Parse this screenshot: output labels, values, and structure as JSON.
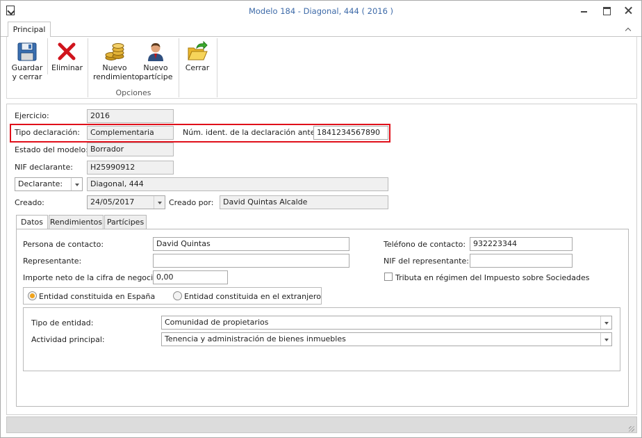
{
  "window": {
    "title": "Modelo 184 - Diagonal, 444 ( 2016 )"
  },
  "ribbon": {
    "tab": "Principal",
    "buttons": {
      "save": [
        "Guardar",
        "y cerrar"
      ],
      "delete": "Eliminar",
      "new_return": [
        "Nuevo",
        "rendimiento"
      ],
      "new_participant": [
        "Nuevo",
        "partícipe"
      ],
      "close": "Cerrar"
    },
    "group_label": "Opciones"
  },
  "form": {
    "ejercicio_label": "Ejercicio:",
    "ejercicio_value": "2016",
    "tipo_label": "Tipo declaración:",
    "tipo_value": "Complementaria",
    "num_ident_label": "Núm. ident. de la declaración anterior:",
    "num_ident_value": "1841234567890",
    "estado_label": "Estado del modelo:",
    "estado_value": "Borrador",
    "nif_label": "NIF declarante:",
    "nif_value": "H25990912",
    "declarante_select": "Declarante:",
    "declarante_value": "Diagonal, 444",
    "creado_label": "Creado:",
    "creado_value": "24/05/2017",
    "creado_por_label": "Creado por:",
    "creado_por_value": "David Quintas Alcalde"
  },
  "tabs": [
    "Datos",
    "Rendimientos",
    "Partícipes"
  ],
  "datos": {
    "contacto_label": "Persona de contacto:",
    "contacto_value": "David Quintas",
    "telefono_label": "Teléfono de contacto:",
    "telefono_value": "932223344",
    "representante_label": "Representante:",
    "representante_value": "",
    "nif_rep_label": "NIF del representante:",
    "nif_rep_value": "",
    "importe_label": "Importe neto de la cifra de negocios:",
    "importe_value": "0,00",
    "tributa_label": "Tributa en régimen del Impuesto sobre Sociedades",
    "radio_espana": "Entidad constituida en España",
    "radio_extranjero": "Entidad constituida en el extranjero",
    "tipo_entidad_label": "Tipo de entidad:",
    "tipo_entidad_value": "Comunidad de propietarios",
    "actividad_label": "Actividad principal:",
    "actividad_value": "Tenencia y administración de bienes inmuebles"
  },
  "colors": {
    "title": "#3d6aa8",
    "highlight": "#e00f1a",
    "radio_selected": "#f0a31c"
  }
}
